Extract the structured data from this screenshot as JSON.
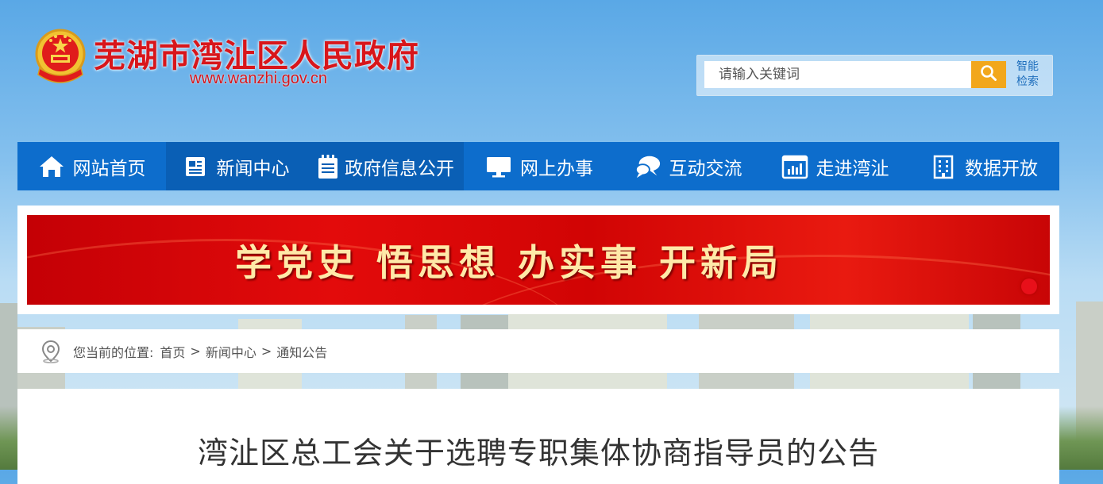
{
  "header": {
    "title": "芜湖市湾沚区人民政府",
    "url": "www.wanzhi.gov.cn"
  },
  "search": {
    "placeholder": "请输入关键词",
    "smart_search_label": "智能检索"
  },
  "nav": {
    "items": [
      {
        "label": "网站首页",
        "icon": "home-icon"
      },
      {
        "label": "新闻中心",
        "icon": "news-icon"
      },
      {
        "label": "政府信息公开",
        "icon": "notepad-icon"
      },
      {
        "label": "网上办事",
        "icon": "monitor-icon"
      },
      {
        "label": "互动交流",
        "icon": "chat-icon"
      },
      {
        "label": "走进湾沚",
        "icon": "stats-icon"
      },
      {
        "label": "数据开放",
        "icon": "building-icon"
      }
    ]
  },
  "banner": {
    "text": "学党史 悟思想 办实事 开新局"
  },
  "breadcrumb": {
    "prefix": "您当前的位置:",
    "items": [
      "首页",
      "新闻中心",
      "通知公告"
    ],
    "separator": ">"
  },
  "article": {
    "title": "湾沚区总工会关于选聘专职集体协商指导员的公告"
  },
  "colors": {
    "nav": "#0d6dcc",
    "brand_red": "#d8161b",
    "search_button": "#f2a71c"
  }
}
